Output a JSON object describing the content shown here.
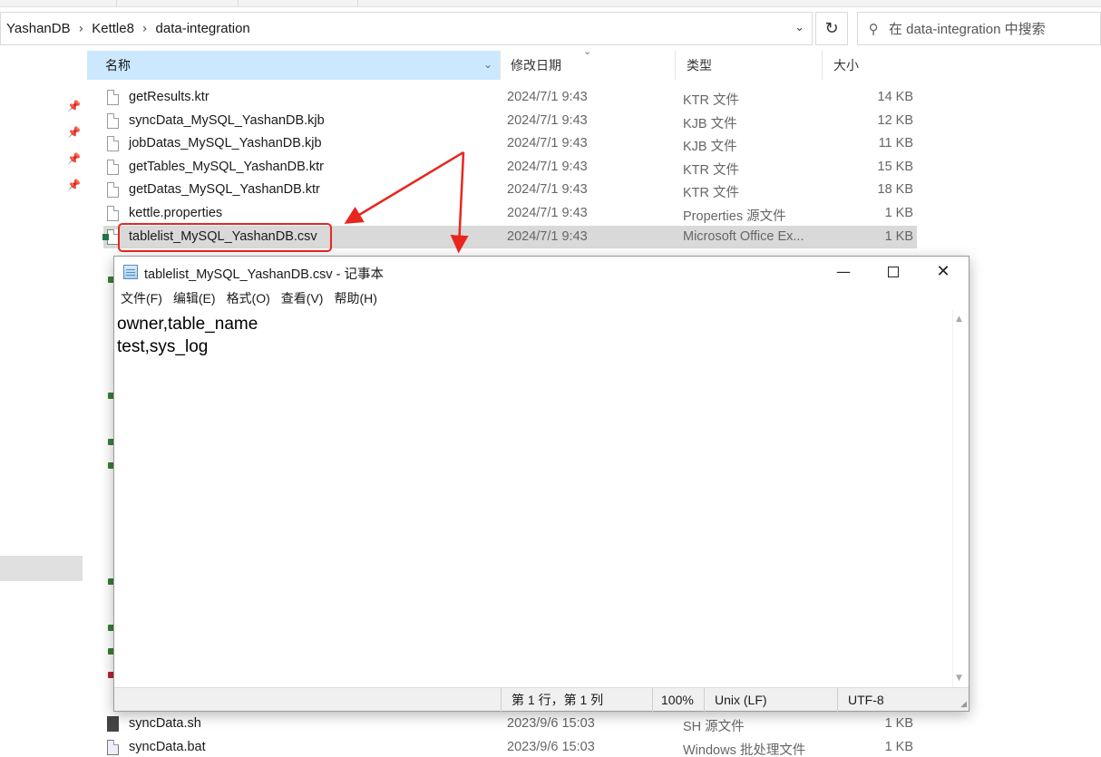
{
  "explorer": {
    "breadcrumb": [
      "YashanDB",
      "Kettle8",
      "data-integration"
    ],
    "search_placeholder": "在 data-integration 中搜索",
    "columns": {
      "name": "名称",
      "date": "修改日期",
      "type": "类型",
      "size": "大小"
    },
    "files_top": [
      {
        "name": "getResults.ktr",
        "date": "2024/7/1 9:43",
        "type": "KTR 文件",
        "size": "14 KB",
        "icon": "file-icon"
      },
      {
        "name": "syncData_MySQL_YashanDB.kjb",
        "date": "2024/7/1 9:43",
        "type": "KJB 文件",
        "size": "12 KB",
        "icon": "file-icon"
      },
      {
        "name": "jobDatas_MySQL_YashanDB.kjb",
        "date": "2024/7/1 9:43",
        "type": "KJB 文件",
        "size": "11 KB",
        "icon": "file-icon"
      },
      {
        "name": "getTables_MySQL_YashanDB.ktr",
        "date": "2024/7/1 9:43",
        "type": "KTR 文件",
        "size": "15 KB",
        "icon": "file-icon"
      },
      {
        "name": "getDatas_MySQL_YashanDB.ktr",
        "date": "2024/7/1 9:43",
        "type": "KTR 文件",
        "size": "18 KB",
        "icon": "file-icon"
      },
      {
        "name": "kettle.properties",
        "date": "2024/7/1 9:43",
        "type": "Properties 源文件",
        "size": "1 KB",
        "icon": "properties-file-icon"
      },
      {
        "name": "tablelist_MySQL_YashanDB.csv",
        "date": "2024/7/1 9:43",
        "type": "Microsoft Office Ex...",
        "size": "1 KB",
        "icon": "csv-file-icon",
        "selected": true
      }
    ],
    "files_bottom": [
      {
        "name": "syncData.sh",
        "date": "2023/9/6 15:03",
        "type": "SH 源文件",
        "size": "1 KB",
        "icon": "shell-script-icon"
      },
      {
        "name": "syncData.bat",
        "date": "2023/9/6 15:03",
        "type": "Windows 批处理文件",
        "size": "1 KB",
        "icon": "batch-file-icon"
      }
    ]
  },
  "notepad": {
    "title": "tablelist_MySQL_YashanDB.csv - 记事本",
    "menus": [
      "文件(F)",
      "编辑(E)",
      "格式(O)",
      "查看(V)",
      "帮助(H)"
    ],
    "content_lines": [
      "owner,table_name",
      "test,sys_log"
    ],
    "status": {
      "position": "第 1 行，第 1 列",
      "zoom": "100%",
      "line_ending": "Unix (LF)",
      "encoding": "UTF-8"
    }
  },
  "annotation": {
    "highlight_color": "#e8261f"
  }
}
